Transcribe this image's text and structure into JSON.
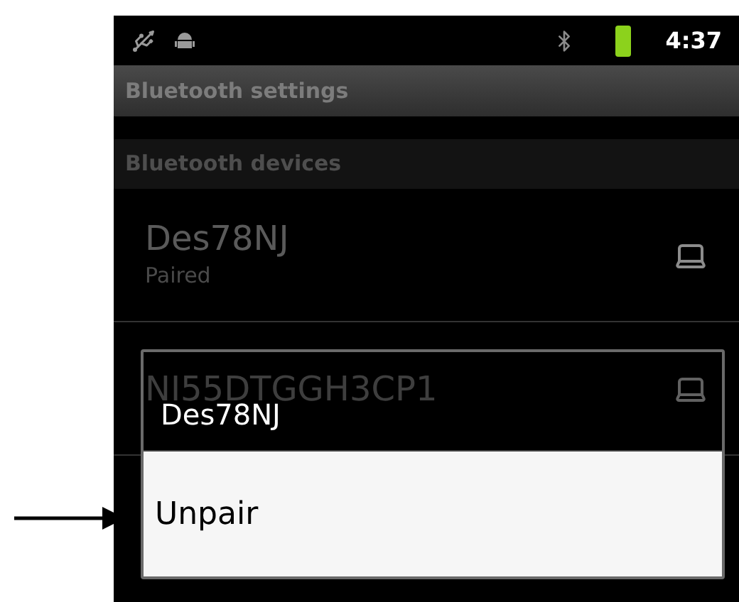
{
  "status_bar": {
    "time": "4:37"
  },
  "title_bar": {
    "title": "Bluetooth settings"
  },
  "section": {
    "title": "Bluetooth devices"
  },
  "devices": [
    {
      "name": "Des78NJ",
      "status": "Paired"
    },
    {
      "name": "NI55DTGGH3CP1"
    }
  ],
  "dialog": {
    "title": "Des78NJ",
    "items": [
      {
        "label": "Unpair",
        "selected": true
      }
    ]
  }
}
